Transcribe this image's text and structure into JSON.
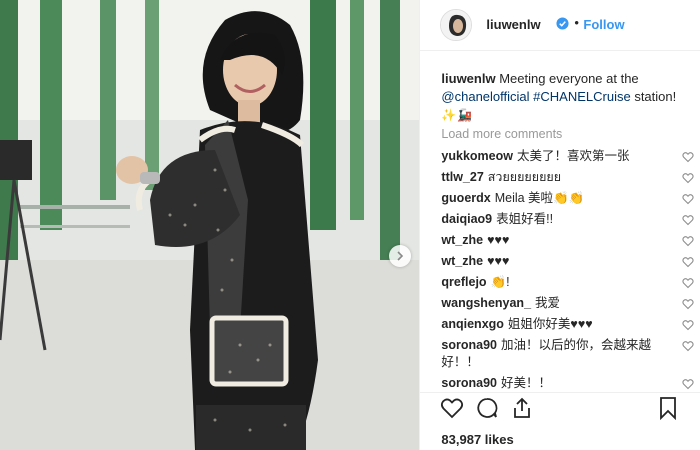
{
  "header": {
    "username": "liuwenlw",
    "dot": "•",
    "follow_label": "Follow"
  },
  "caption": {
    "username": "liuwenlw",
    "text_before": " Meeting everyone at the ",
    "mention": "@chanelofficial",
    "hashtag": "#CHANELCruise",
    "text_after": " station!",
    "emoji": "✨🚂"
  },
  "load_more": "Load more comments",
  "comments": [
    {
      "user": "yukkomeow",
      "text": "太美了！喜欢第一张"
    },
    {
      "user": "ttlw_27",
      "text": "สวยยยยยยยย"
    },
    {
      "user": "guoerdx",
      "text": "Meila 美啦👏👏"
    },
    {
      "user": "daiqiao9",
      "text": "表姐好看!!"
    },
    {
      "user": "wt_zhe",
      "text": "♥♥♥"
    },
    {
      "user": "wt_zhe",
      "text": "♥♥♥"
    },
    {
      "user": "qreflejo",
      "text": "👏!"
    },
    {
      "user": "wangshenyan_",
      "text": "我爱"
    },
    {
      "user": "anqienxgo",
      "text": "姐姐你好美♥♥♥"
    },
    {
      "user": "sorona90",
      "text": "加油！以后的你，会越来越好！！"
    },
    {
      "user": "sorona90",
      "text": "好美！！"
    }
  ],
  "likes": "83,987 likes",
  "icons": {
    "verified": "verified-badge-icon",
    "like": "heart-icon",
    "comment": "comment-bubble-icon",
    "share": "share-icon",
    "save": "bookmark-icon",
    "next": "chevron-right-icon"
  },
  "colors": {
    "follow": "#3897f0",
    "link": "#003569",
    "muted": "#999999",
    "verified": "#3897f0"
  }
}
